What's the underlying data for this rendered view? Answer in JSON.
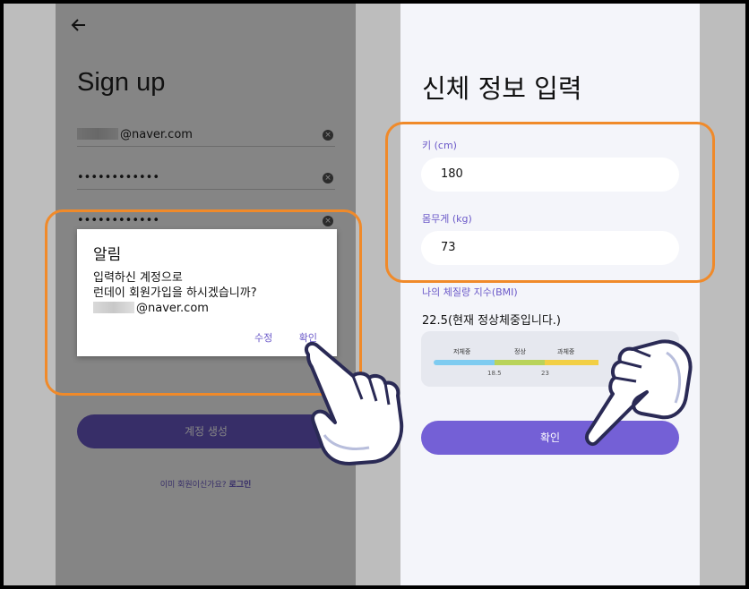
{
  "signup": {
    "title": "Sign up",
    "email_suffix": "@naver.com",
    "password_mask": "••••••••••••",
    "confirm_mask": "••••••••••••",
    "create_button": "계정 생성",
    "login_prompt": "이미 회원이신가요?",
    "login_link": "로그인"
  },
  "dialog": {
    "title": "알림",
    "message_line1": "입력하신 계정으로",
    "message_line2": "런데이 회원가입을 하시겠습니까?",
    "email_suffix": "@naver.com",
    "edit_button": "수정",
    "ok_button": "확인"
  },
  "body_info": {
    "title": "신체 정보 입력",
    "height_label": "키 (cm)",
    "height_value": "180",
    "weight_label": "몸무게 (kg)",
    "weight_value": "73",
    "bmi_label": "나의 체질량 지수(BMI)",
    "bmi_value": "22.5(현재 정상체중입니다.)",
    "bmi_categories": [
      "저체중",
      "정상",
      "과체중"
    ],
    "bmi_thresholds": [
      "18.5",
      "23"
    ],
    "confirm_button": "확인"
  },
  "colors": {
    "accent": "#6a58c8",
    "highlight": "#f08a2a",
    "underweight": "#7ecbf0",
    "normal": "#b9d35a",
    "overweight": "#f2cf45"
  }
}
